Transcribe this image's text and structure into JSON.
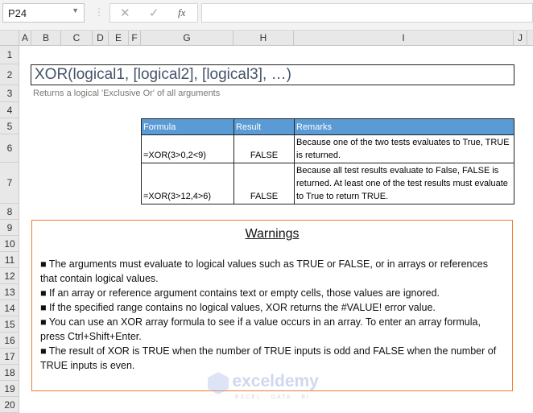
{
  "formula_bar": {
    "name_box": "P24",
    "cancel_icon": "✕",
    "enter_icon": "✓",
    "fx_label": "fx",
    "content": ""
  },
  "columns": [
    "A",
    "B",
    "C",
    "D",
    "E",
    "F",
    "G",
    "H",
    "I",
    "J"
  ],
  "rows": [
    "1",
    "2",
    "3",
    "4",
    "5",
    "6",
    "7",
    "8",
    "9",
    "10",
    "11",
    "12",
    "13",
    "14",
    "15",
    "16",
    "17",
    "18",
    "19",
    "20"
  ],
  "title": "XOR(logical1, [logical2], [logical3], …)",
  "subtitle": "Returns a logical 'Exclusive Or' of all arguments",
  "table": {
    "headers": [
      "Formula",
      "Result",
      "Remarks"
    ],
    "rows": [
      {
        "formula": "=XOR(3>0,2<9)",
        "result": "FALSE",
        "remarks": "Because one of the two tests evaluates to True, TRUE is returned."
      },
      {
        "formula": "=XOR(3>12,4>6)",
        "result": "FALSE",
        "remarks": "Because all test results evaluate to False, FALSE is returned. At least one of the test results must evaluate to True to return TRUE."
      }
    ]
  },
  "warnings": {
    "title": "Warnings",
    "items": [
      "■ The arguments must evaluate to logical values such as TRUE or FALSE, or in arrays or references that contain logical values.",
      "■ If an array or reference argument contains text or empty cells, those values are ignored.",
      "■ If the specified range contains no logical values, XOR returns the #VALUE! error value.",
      "■ You can use an XOR array formula to see if a value occurs in an array. To enter an array formula, press Ctrl+Shift+Enter.",
      "■ The result of XOR is TRUE when the number of TRUE inputs is odd and FALSE when the number of TRUE inputs is even."
    ]
  },
  "watermark": {
    "name": "exceldemy",
    "tagline": "EXCEL · DATA · BI"
  }
}
